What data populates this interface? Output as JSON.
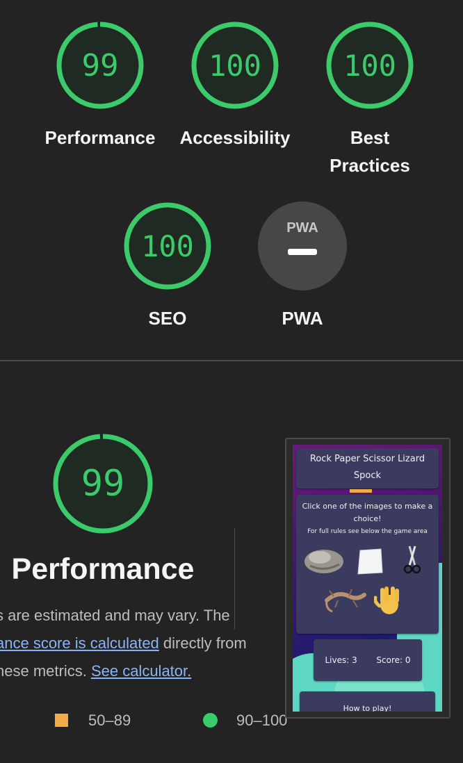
{
  "scores": [
    {
      "value": "99",
      "label_lines": [
        "Performance"
      ],
      "fraction": 0.99
    },
    {
      "value": "100",
      "label_lines": [
        "Accessibility"
      ],
      "fraction": 1.0
    },
    {
      "value": "100",
      "label_lines": [
        "Best",
        "Practices"
      ],
      "fraction": 1.0
    },
    {
      "value": "100",
      "label_lines": [
        "SEO"
      ],
      "fraction": 1.0
    }
  ],
  "pwa": {
    "badge_text": "PWA",
    "label": "PWA",
    "status": "not applicable"
  },
  "performance": {
    "score": "99",
    "fraction": 0.99,
    "title": "Performance",
    "desc_line1": "s are estimated and may vary. The",
    "desc_link1": "ance score is calculated",
    "desc_line2_rest": " directly from",
    "desc_line3_pre": "hese metrics. ",
    "desc_link2": "See calculator."
  },
  "legend": {
    "average": "50–89",
    "pass": "90–100"
  },
  "colors": {
    "pass": "#3bcb6b",
    "average": "#f2ab47",
    "background": "#232323",
    "gauge_fill": "#1f2a22"
  },
  "screenshot": {
    "title": "Rock Paper Scissor Lizard Spock",
    "instruction": "Click one of the images to make a choice!",
    "rules_hint": "For full rules see below the game area",
    "choices": [
      "rock-icon",
      "paper-icon",
      "scissors-icon",
      "lizard-icon",
      "spock-hand-icon"
    ],
    "lives": "Lives: 3",
    "score": "Score: 0",
    "how_to_play": "How to play!"
  }
}
